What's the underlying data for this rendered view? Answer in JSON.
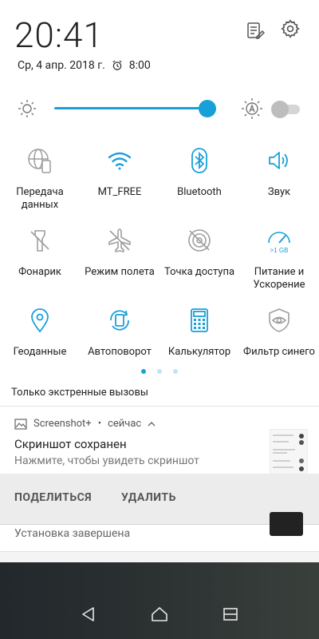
{
  "header": {
    "time": "20:41",
    "date": "Ср, 4 апр. 2018 г.",
    "alarm_time": "8:00",
    "edit_icon": "edit-notes-icon",
    "settings_icon": "gear-icon"
  },
  "brightness": {
    "level_fraction": 1.0,
    "auto_icon": "auto-brightness-icon",
    "auto_enabled": false
  },
  "quick_tiles": [
    {
      "label": "Передача данных",
      "icon": "mobile-data-icon",
      "active": false
    },
    {
      "label": "MT_FREE",
      "icon": "wifi-icon",
      "active": true
    },
    {
      "label": "Bluetooth",
      "icon": "bluetooth-icon",
      "active": true
    },
    {
      "label": "Звук",
      "icon": "volume-icon",
      "active": true
    },
    {
      "label": "Фонарик",
      "icon": "flashlight-off-icon",
      "active": false
    },
    {
      "label": "Режим полета",
      "icon": "airplane-icon",
      "active": false
    },
    {
      "label": "Точка доступа",
      "icon": "hotspot-off-icon",
      "active": false
    },
    {
      "label": "Питание и Ускорение",
      "icon": "boost-gauge-icon",
      "active": true,
      "badge": ">1 GB"
    },
    {
      "label": "Геоданные",
      "icon": "location-icon",
      "active": true
    },
    {
      "label": "Автоповорот",
      "icon": "auto-rotate-icon",
      "active": true
    },
    {
      "label": "Калькулятор",
      "icon": "calculator-icon",
      "active": true
    },
    {
      "label": "Фильтр синего",
      "icon": "blue-filter-icon",
      "active": false
    }
  ],
  "page_dots": {
    "count": 3,
    "active": 0
  },
  "emergency_text": "Только экстренные вызовы",
  "notification": {
    "app_name": "Screenshot+",
    "separator": "•",
    "time": "сейчас",
    "title": "Скриншот сохранен",
    "text": "Нажмите, чтобы увидеть скриншот",
    "actions": [
      "ПОДЕЛИТЬСЯ",
      "УДАЛИТЬ"
    ]
  },
  "notification2": {
    "text": "Установка завершена"
  },
  "colors": {
    "accent": "#1aa0d8",
    "inactive_icon": "#9e9e9e",
    "text": "#222222"
  }
}
